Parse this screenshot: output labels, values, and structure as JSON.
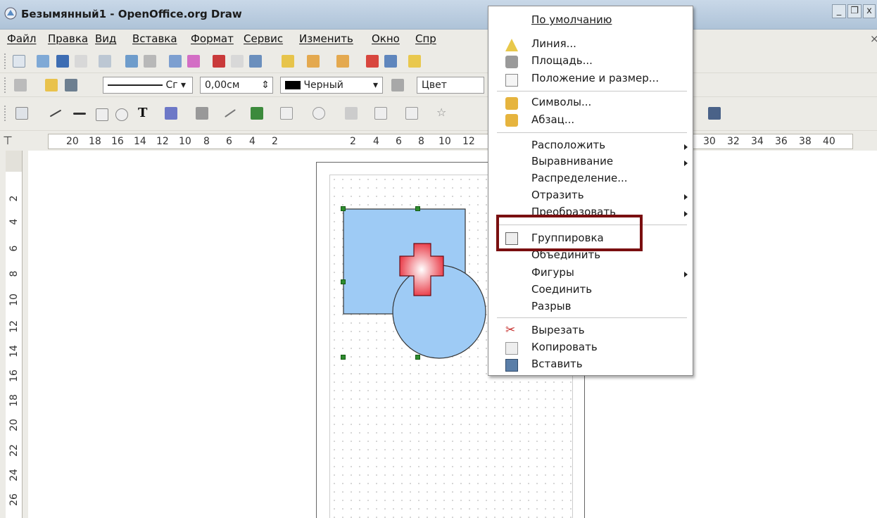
{
  "window": {
    "title": "Безымянный1 - OpenOffice.org Draw"
  },
  "menubar": [
    "Файл",
    "Правка",
    "Вид",
    "Вставка",
    "Формат",
    "Сервис",
    "Изменить",
    "Окно",
    "Спр"
  ],
  "toolbar_line": {
    "line_style_partial": "Сг",
    "line_width": "0,00см",
    "line_color": "Черный",
    "area_color": "Цвет"
  },
  "ruler_top": [
    "20",
    "18",
    "16",
    "14",
    "12",
    "10",
    "8",
    "6",
    "4",
    "2",
    "2",
    "4",
    "6",
    "8",
    "10",
    "12",
    "30",
    "32",
    "34",
    "36",
    "38",
    "40"
  ],
  "ruler_left": [
    "2",
    "4",
    "6",
    "8",
    "10",
    "12",
    "14",
    "16",
    "18",
    "20",
    "22",
    "24",
    "26"
  ],
  "context_menu": {
    "items": [
      {
        "label": "По умолчанию",
        "icon": ""
      },
      {
        "label": "Линия...",
        "icon": "line-icon"
      },
      {
        "label": "Площадь...",
        "icon": "area-icon"
      },
      {
        "label": "Положение и размер...",
        "icon": "position-size-icon"
      },
      {
        "label": "Символы...",
        "icon": "characters-icon"
      },
      {
        "label": "Абзац...",
        "icon": "paragraph-icon"
      },
      {
        "label": "Расположить",
        "icon": "",
        "submenu": true
      },
      {
        "label": "Выравнивание",
        "icon": "",
        "submenu": true
      },
      {
        "label": "Распределение...",
        "icon": ""
      },
      {
        "label": "Отразить",
        "icon": "",
        "submenu": true
      },
      {
        "label": "Преобразовать",
        "icon": "",
        "submenu": true
      },
      {
        "label": "Группировка",
        "icon": "group-icon"
      },
      {
        "label": "Объединить",
        "icon": ""
      },
      {
        "label": "Фигуры",
        "icon": "",
        "submenu": true
      },
      {
        "label": "Соединить",
        "icon": ""
      },
      {
        "label": "Разрыв",
        "icon": ""
      },
      {
        "label": "Вырезать",
        "icon": "cut-icon"
      },
      {
        "label": "Копировать",
        "icon": "copy-icon"
      },
      {
        "label": "Вставить",
        "icon": "paste-icon"
      }
    ]
  },
  "colors": {
    "highlight": "#7a0f10",
    "shape_fill": "#9ecbf5",
    "cross_fill": "#f05a6a",
    "selection_handle": "#2f8c2f"
  }
}
